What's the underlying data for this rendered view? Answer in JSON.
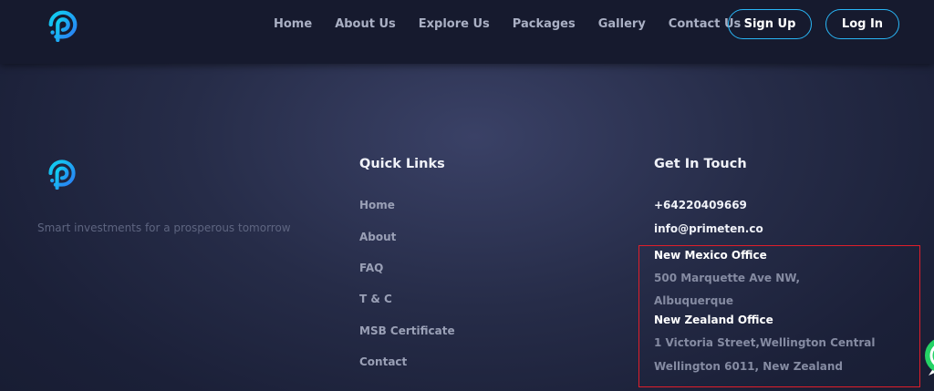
{
  "nav": {
    "links": [
      "Home",
      "About Us",
      "Explore Us",
      "Packages",
      "Gallery",
      "Contact Us"
    ],
    "signup": "Sign Up",
    "login": "Log In"
  },
  "footer": {
    "tagline": "Smart investments for a prosperous tomorrow",
    "quick_links": {
      "title": "Quick Links",
      "items": [
        "Home",
        "About",
        "FAQ",
        "T & C",
        "MSB Certificate",
        "Contact"
      ]
    },
    "get_in_touch": {
      "title": "Get In Touch",
      "phone": "+64220409669",
      "email": "info@primeten.co",
      "offices": [
        {
          "name": "New Mexico Office",
          "lines": [
            "500 Marquette Ave NW,",
            "Albuquerque"
          ]
        },
        {
          "name": "New Zealand Office",
          "lines": [
            "1 Victoria Street,Wellington Central",
            "Wellington 6011, New Zealand"
          ]
        }
      ]
    }
  },
  "colors": {
    "accent": "#29b6f6",
    "logo_gradient": [
      "#0fd3f0",
      "#2a7ff5"
    ],
    "highlight": "#e01e2a",
    "whatsapp": "#25d366"
  }
}
